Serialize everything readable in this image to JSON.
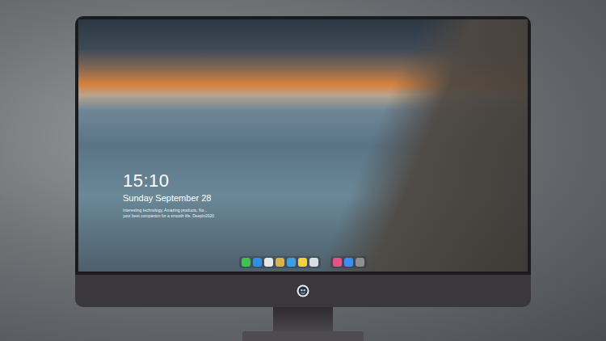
{
  "screen": {
    "clock": "15:10",
    "date": "Sunday September 28",
    "tagline": [
      "Interesting technology, Amazing products, No...",
      "your best companion for a smooth life. Deepin2020"
    ]
  },
  "dock": {
    "groups": [
      {
        "items": [
          {
            "color": "#3fc34f"
          },
          {
            "color": "#2f8ee8"
          },
          {
            "color": "#e6e6e6"
          },
          {
            "color": "#d9b24a"
          },
          {
            "color": "#3aa0e0"
          },
          {
            "color": "#f2d13a"
          },
          {
            "color": "#d8dde2"
          }
        ]
      },
      {
        "items": [
          {
            "color": "#e8508a"
          },
          {
            "color": "#3a8ff0"
          },
          {
            "color": "#8c8f94"
          }
        ]
      }
    ]
  }
}
